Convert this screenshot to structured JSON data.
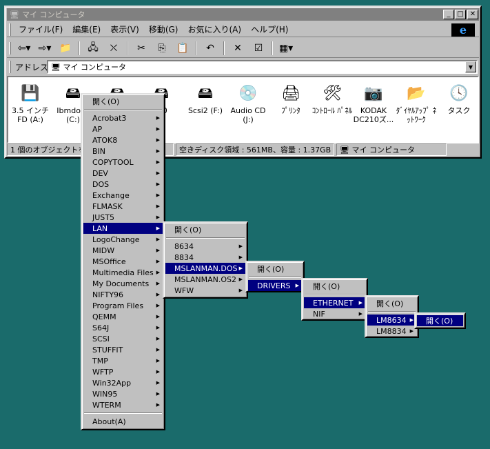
{
  "window": {
    "title": "マイ コンピュータ",
    "controls": {
      "minimize": "_",
      "maximize": "□",
      "close": "✕"
    },
    "menu": [
      "ファイル(F)",
      "編集(E)",
      "表示(V)",
      "移動(G)",
      "お気に入り(A)",
      "ヘルプ(H)"
    ],
    "logo_letter": "e",
    "toolbar_icons": [
      "back-icon",
      "forward-icon",
      "up-folder-icon",
      "map-drive-icon",
      "disconnect-drive-icon",
      "cut-icon",
      "copy-icon",
      "paste-icon",
      "undo-icon",
      "delete-icon",
      "properties-icon",
      "views-icon"
    ],
    "address_label": "アドレス",
    "address_value": "マイ コンピュータ",
    "icons": [
      {
        "label": "3.5 インチ FD (A:)",
        "icon": "floppy-drive-icon"
      },
      {
        "label": "Ibmdos6 (C:)",
        "icon": "hard-drive-icon"
      },
      {
        "label": "",
        "icon": "hard-drive-icon"
      },
      {
        "label": "...0",
        "icon": "hard-drive-icon"
      },
      {
        "label": "Scsi2 (F:)",
        "icon": "hard-drive-icon"
      },
      {
        "label": "Audio CD (J:)",
        "icon": "cd-drive-icon"
      },
      {
        "label": "ﾌﾟﾘﾝﾀ",
        "icon": "printers-folder-icon"
      },
      {
        "label": "ｺﾝﾄﾛｰﾙ ﾊﾟﾈﾙ",
        "icon": "control-panel-icon"
      },
      {
        "label": "KODAK DC210ズ...",
        "icon": "camera-icon"
      },
      {
        "label": "ﾀﾞｲﾔﾙｱｯﾌﾟ ﾈｯﾄﾜｰｸ",
        "icon": "dialup-network-icon"
      },
      {
        "label": "タスク",
        "icon": "scheduled-tasks-icon"
      }
    ],
    "status": [
      "1 個のオブジェクトを選",
      "空きディスク領域 : 561MB、容量 : 1.37GB",
      "マイ コンピュータ"
    ]
  },
  "menus": {
    "root": {
      "open": "開く(O)",
      "items": [
        "Acrobat3",
        "AP",
        "ATOK8",
        "BIN",
        "COPYTOOL",
        "DEV",
        "DOS",
        "Exchange",
        "FLMASK",
        "JUST5",
        "LAN",
        "LogoChange",
        "MIDW",
        "MSOffice",
        "Multimedia Files",
        "My Documents",
        "NIFTY96",
        "Program Files",
        "QEMM",
        "S64J",
        "SCSI",
        "STUFFIT",
        "TMP",
        "WFTP",
        "Win32App",
        "WIN95",
        "WTERM"
      ],
      "about": "About(A)"
    },
    "lan": {
      "open": "開く(O)",
      "items": [
        "8634",
        "8834",
        "MSLANMAN.DOS",
        "MSLANMAN.OS2",
        "WFW"
      ]
    },
    "mslanman": {
      "open": "開く(O)",
      "items": [
        "DRIVERS"
      ]
    },
    "drivers": {
      "open": "開く(O)",
      "items": [
        "ETHERNET",
        "NIF"
      ]
    },
    "ethernet": {
      "open": "開く(O)",
      "items": [
        "LM8634",
        "LM8834"
      ]
    },
    "lm8634": {
      "open": "開く(O)"
    }
  }
}
